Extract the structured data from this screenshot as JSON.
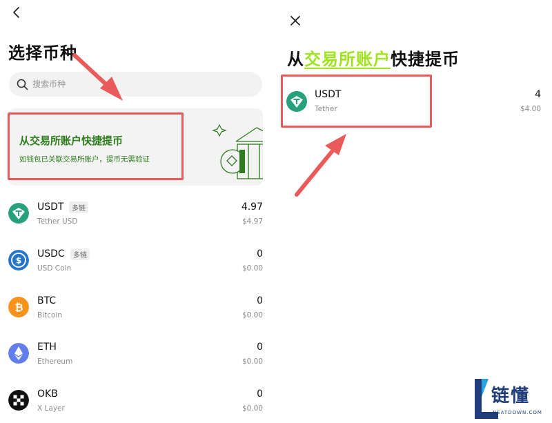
{
  "left": {
    "title": "选择币种",
    "search": {
      "placeholder": "搜索币种"
    },
    "banner": {
      "title": "从交易所账户快捷提币",
      "subtitle": "如钱包已关联交易所账户，提币无需验证"
    },
    "coins": [
      {
        "symbol": "USDT",
        "badge": "多链",
        "name": "Tether USD",
        "amount": "4.97",
        "fiat": "$4.97",
        "icon": "tether-icon",
        "color": "#26a17b"
      },
      {
        "symbol": "USDC",
        "badge": "多链",
        "name": "USD Coin",
        "amount": "0",
        "fiat": "$0.00",
        "icon": "usdc-icon",
        "color": "#2775ca"
      },
      {
        "symbol": "BTC",
        "badge": "",
        "name": "Bitcoin",
        "amount": "0",
        "fiat": "$0.00",
        "icon": "bitcoin-icon",
        "color": "#f7931a"
      },
      {
        "symbol": "ETH",
        "badge": "",
        "name": "Ethereum",
        "amount": "0",
        "fiat": "$0.00",
        "icon": "ethereum-icon",
        "color": "#627eea"
      },
      {
        "symbol": "OKB",
        "badge": "",
        "name": "X Layer",
        "amount": "0",
        "fiat": "$0.00",
        "icon": "okb-icon",
        "color": "#111111"
      }
    ]
  },
  "right": {
    "title_prefix": "从",
    "title_highlight": "交易所账户",
    "title_suffix": "快捷提币",
    "coin": {
      "symbol": "USDT",
      "name": "Tether",
      "amount": "4",
      "fiat": "$4.00",
      "icon": "tether-icon",
      "color": "#26a17b"
    }
  },
  "watermark": {
    "text": "链懂",
    "sub": "NEATDOWN.COM"
  },
  "colors": {
    "accent_green": "#9fe31c",
    "banner_green": "#2e7d1f",
    "annotation_red": "#e95a5a"
  }
}
